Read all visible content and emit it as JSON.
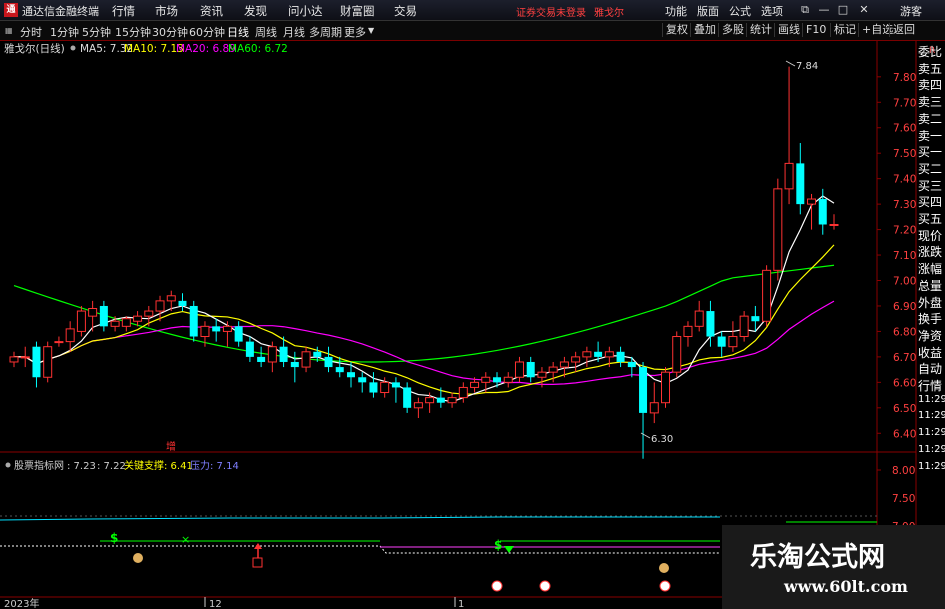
{
  "titlebar": {
    "app_title": "通达信金融终端",
    "menus": [
      "行情",
      "市场",
      "资讯",
      "发现",
      "问小达",
      "财富圈",
      "交易"
    ],
    "trade_notice": "证券交易未登录",
    "stock_name": "雅戈尔",
    "right_menus": [
      "功能",
      "版面",
      "公式",
      "选项"
    ]
  },
  "toolbar": {
    "periods": [
      "分时",
      "1分钟",
      "5分钟",
      "15分钟",
      "30分钟",
      "60分钟",
      "日线",
      "周线",
      "月线",
      "多周期",
      "更多"
    ],
    "active_period": "日线",
    "right_buttons": [
      "复权",
      "叠加",
      "多股",
      "统计",
      "画线",
      "F10",
      "标记",
      "+自选",
      "返回"
    ],
    "guest_label": "游客"
  },
  "main_legend": {
    "name": "雅戈尔(日线)",
    "ma5": "MA5: 7.32",
    "ma10": "MA10: 7.13",
    "ma20": "MA20: 6.89",
    "ma60": "MA60: 6.72"
  },
  "price_axis": {
    "labels": [
      "7.80",
      "7.70",
      "7.60",
      "7.50",
      "7.40",
      "7.30",
      "7.20",
      "7.10",
      "7.00",
      "6.90",
      "6.80",
      "6.70",
      "6.60",
      "6.50",
      "6.40"
    ],
    "top_label": "R"
  },
  "annotations": {
    "high": "7.84",
    "low": "6.30",
    "marker": "增"
  },
  "indicator": {
    "name": "股票指标网",
    "v1": ": 7.23",
    "v2": ": 7.22",
    "support": "关键支撑: 6.41",
    "pressure": "压力: 7.14",
    "axis": [
      "8.00",
      "7.50",
      "7.00"
    ]
  },
  "right_panel": [
    "委比",
    "卖五",
    "卖四",
    "卖三",
    "卖二",
    "卖一",
    "买一",
    "买二",
    "买三",
    "买四",
    "买五",
    "现价",
    "涨跌",
    "涨幅",
    "总量",
    "外盘",
    "换手",
    "净资",
    "收益",
    "自动",
    "行情",
    "11:29",
    "11:29",
    "11:29",
    "11:29",
    "11:29"
  ],
  "date_axis": {
    "labels": [
      "2023年",
      "12",
      "1"
    ]
  },
  "watermark": {
    "cn": "乐淘公式网",
    "url": "www.60lt.com"
  },
  "colors": {
    "up": "#ff3232",
    "down": "#00ffff",
    "ma5": "#ffffff",
    "ma10": "#ffff00",
    "ma20": "#ff00ff",
    "ma60": "#00ff00",
    "accent_red": "#c8161d"
  },
  "chart_data": {
    "type": "candlestick",
    "ylim": [
      6.35,
      7.87
    ],
    "candles": [
      [
        6.68,
        6.72,
        6.66,
        6.7
      ],
      [
        6.7,
        6.74,
        6.66,
        6.7
      ],
      [
        6.74,
        6.76,
        6.58,
        6.62
      ],
      [
        6.62,
        6.76,
        6.6,
        6.74
      ],
      [
        6.76,
        6.78,
        6.74,
        6.76
      ],
      [
        6.76,
        6.84,
        6.72,
        6.81
      ],
      [
        6.8,
        6.9,
        6.78,
        6.88
      ],
      [
        6.86,
        6.92,
        6.8,
        6.89
      ],
      [
        6.9,
        6.92,
        6.8,
        6.82
      ],
      [
        6.82,
        6.86,
        6.8,
        6.84
      ],
      [
        6.82,
        6.86,
        6.8,
        6.85
      ],
      [
        6.84,
        6.88,
        6.82,
        6.86
      ],
      [
        6.86,
        6.9,
        6.82,
        6.88
      ],
      [
        6.88,
        6.94,
        6.84,
        6.92
      ],
      [
        6.92,
        6.96,
        6.88,
        6.94
      ],
      [
        6.92,
        6.95,
        6.88,
        6.9
      ],
      [
        6.9,
        6.92,
        6.76,
        6.78
      ],
      [
        6.78,
        6.84,
        6.74,
        6.82
      ],
      [
        6.82,
        6.85,
        6.76,
        6.8
      ],
      [
        6.8,
        6.84,
        6.74,
        6.82
      ],
      [
        6.82,
        6.84,
        6.74,
        6.76
      ],
      [
        6.76,
        6.78,
        6.68,
        6.7
      ],
      [
        6.7,
        6.74,
        6.66,
        6.68
      ],
      [
        6.68,
        6.76,
        6.64,
        6.74
      ],
      [
        6.74,
        6.78,
        6.66,
        6.68
      ],
      [
        6.68,
        6.72,
        6.6,
        6.66
      ],
      [
        6.66,
        6.74,
        6.64,
        6.72
      ],
      [
        6.72,
        6.74,
        6.68,
        6.7
      ],
      [
        6.7,
        6.74,
        6.64,
        6.66
      ],
      [
        6.66,
        6.7,
        6.62,
        6.64
      ],
      [
        6.64,
        6.68,
        6.58,
        6.62
      ],
      [
        6.62,
        6.64,
        6.56,
        6.6
      ],
      [
        6.6,
        6.64,
        6.54,
        6.56
      ],
      [
        6.56,
        6.62,
        6.54,
        6.6
      ],
      [
        6.6,
        6.62,
        6.52,
        6.58
      ],
      [
        6.58,
        6.6,
        6.48,
        6.5
      ],
      [
        6.5,
        6.54,
        6.46,
        6.52
      ],
      [
        6.52,
        6.56,
        6.48,
        6.54
      ],
      [
        6.54,
        6.58,
        6.5,
        6.52
      ],
      [
        6.52,
        6.56,
        6.5,
        6.54
      ],
      [
        6.54,
        6.6,
        6.52,
        6.58
      ],
      [
        6.58,
        6.62,
        6.56,
        6.6
      ],
      [
        6.6,
        6.64,
        6.56,
        6.62
      ],
      [
        6.62,
        6.64,
        6.58,
        6.6
      ],
      [
        6.6,
        6.64,
        6.58,
        6.62
      ],
      [
        6.62,
        6.7,
        6.6,
        6.68
      ],
      [
        6.68,
        6.7,
        6.6,
        6.62
      ],
      [
        6.62,
        6.66,
        6.58,
        6.64
      ],
      [
        6.64,
        6.68,
        6.6,
        6.66
      ],
      [
        6.66,
        6.7,
        6.62,
        6.68
      ],
      [
        6.68,
        6.72,
        6.64,
        6.7
      ],
      [
        6.7,
        6.74,
        6.66,
        6.72
      ],
      [
        6.72,
        6.76,
        6.68,
        6.7
      ],
      [
        6.7,
        6.74,
        6.66,
        6.72
      ],
      [
        6.72,
        6.74,
        6.66,
        6.68
      ],
      [
        6.68,
        6.7,
        6.62,
        6.66
      ],
      [
        6.66,
        6.68,
        6.3,
        6.48
      ],
      [
        6.48,
        6.6,
        6.44,
        6.52
      ],
      [
        6.52,
        6.66,
        6.5,
        6.64
      ],
      [
        6.64,
        6.8,
        6.62,
        6.78
      ],
      [
        6.78,
        6.84,
        6.74,
        6.82
      ],
      [
        6.82,
        6.92,
        6.8,
        6.88
      ],
      [
        6.88,
        6.92,
        6.74,
        6.78
      ],
      [
        6.78,
        6.8,
        6.7,
        6.74
      ],
      [
        6.74,
        6.84,
        6.72,
        6.78
      ],
      [
        6.78,
        6.88,
        6.76,
        6.86
      ],
      [
        6.86,
        6.9,
        6.8,
        6.84
      ],
      [
        6.84,
        7.06,
        6.82,
        7.04
      ],
      [
        7.04,
        7.4,
        7.0,
        7.36
      ],
      [
        7.36,
        7.84,
        7.3,
        7.46
      ],
      [
        7.46,
        7.54,
        7.26,
        7.3
      ],
      [
        7.3,
        7.34,
        7.2,
        7.32
      ],
      [
        7.32,
        7.36,
        7.18,
        7.22
      ],
      [
        7.22,
        7.26,
        7.2,
        7.22
      ]
    ]
  }
}
